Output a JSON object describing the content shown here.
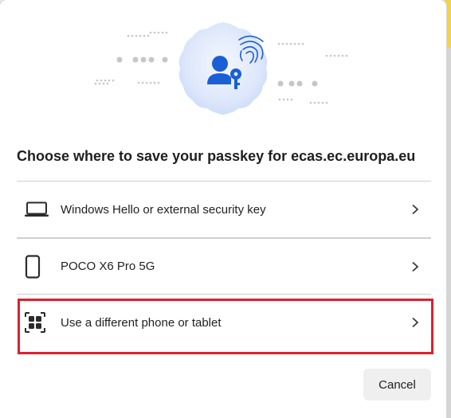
{
  "dialog": {
    "title": "Choose where to save your passkey for ecas.ec.europa.eu",
    "hero_icon": "passkey-user-key-icon",
    "accent_color": "#1a5fd6",
    "options": [
      {
        "label": "Windows Hello or external security key",
        "icon": "laptop-icon"
      },
      {
        "label": "POCO X6 Pro 5G",
        "icon": "phone-icon"
      },
      {
        "label": "Use a different phone or tablet",
        "icon": "qr-code-icon"
      }
    ],
    "cancel_label": "Cancel",
    "highlight_color": "#e01f2d"
  }
}
